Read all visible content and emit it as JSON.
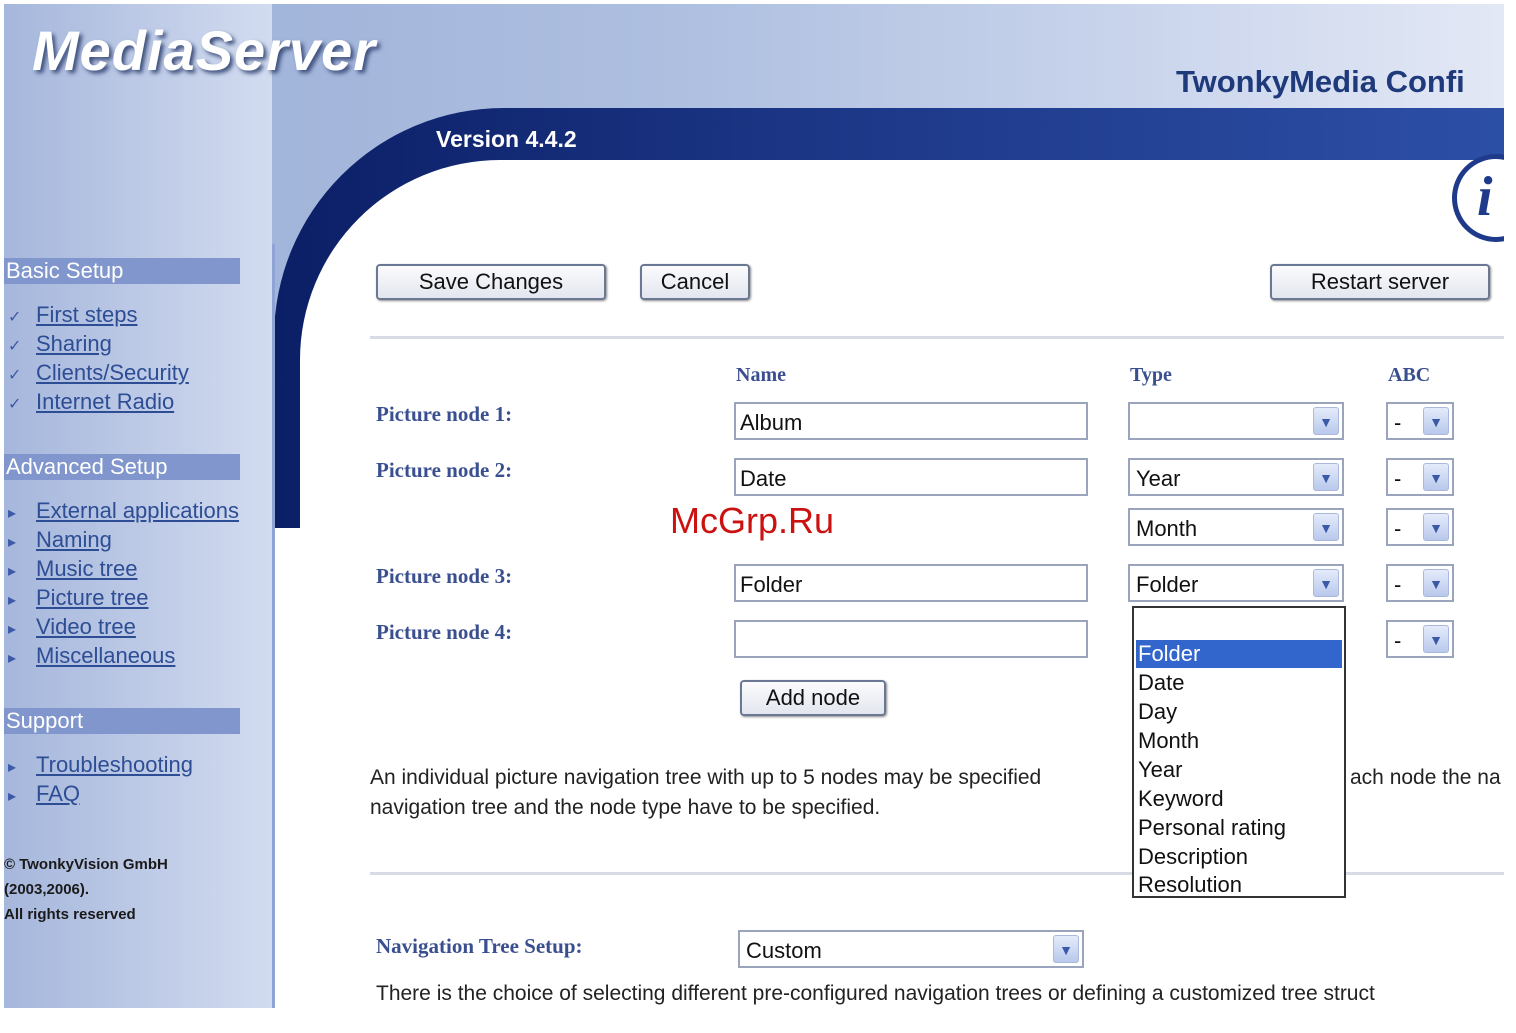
{
  "header": {
    "logo": "MediaServer",
    "subtitle": "TwonkyMedia Confi",
    "version": "Version 4.4.2",
    "info_glyph": "i"
  },
  "sidebar": {
    "sections": [
      {
        "title": "Basic Setup",
        "items": [
          "First steps",
          "Sharing",
          "Clients/Security",
          "Internet Radio"
        ]
      },
      {
        "title": "Advanced Setup",
        "items": [
          "External applications",
          "Naming",
          "Music tree",
          "Picture tree",
          "Video tree",
          "Miscellaneous"
        ]
      },
      {
        "title": "Support",
        "items": [
          "Troubleshooting",
          "FAQ"
        ]
      }
    ],
    "copyright": [
      "© TwonkyVision GmbH",
      "(2003,2006).",
      "All rights reserved"
    ]
  },
  "toolbar": {
    "save_label": "Save Changes",
    "cancel_label": "Cancel",
    "restart_label": "Restart server"
  },
  "columns": {
    "name": "Name",
    "type": "Type",
    "abc": "ABC"
  },
  "nodes": [
    {
      "label": "Picture node 1:",
      "name": "Album",
      "type": "",
      "abc": "-"
    },
    {
      "label": "Picture node 2:",
      "name": "Date",
      "type": "Year",
      "abc": "-"
    },
    {
      "label": "",
      "name": "",
      "type": "Month",
      "abc": "-"
    },
    {
      "label": "Picture node 3:",
      "name": "Folder",
      "type": "Folder",
      "abc": "-"
    },
    {
      "label": "Picture node 4:",
      "name": "",
      "type": "",
      "abc": "-"
    }
  ],
  "add_node_label": "Add node",
  "type_dropdown": {
    "options": [
      "",
      "Folder",
      "Date",
      "Day",
      "Month",
      "Year",
      "Keyword",
      "Personal rating",
      "Description",
      "Resolution"
    ],
    "selected": "Folder"
  },
  "description": {
    "line1_left": "An individual picture navigation tree with up to 5 nodes may be specified",
    "line1_right": "ach node the na",
    "line2": "navigation tree and the node type have to be specified."
  },
  "nav_tree": {
    "label": "Navigation Tree Setup:",
    "value": "Custom",
    "help": "There is the choice of selecting different pre-configured navigation trees or defining a customized tree struct"
  },
  "watermark": "McGrp.Ru"
}
